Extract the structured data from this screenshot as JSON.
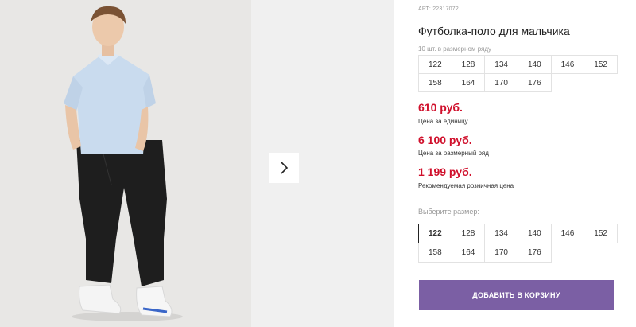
{
  "product": {
    "article_label": "Арт:",
    "article_value": "22317072",
    "title": "Футболка-поло для мальчика",
    "count_note": "10 шт. в размерном ряду",
    "size_range": [
      "122",
      "128",
      "134",
      "140",
      "146",
      "152",
      "158",
      "164",
      "170",
      "176"
    ],
    "prices": [
      {
        "value": "610 руб.",
        "note": "Цена за единицу"
      },
      {
        "value": "6 100 руб.",
        "note": "Цена за размерный ряд"
      },
      {
        "value": "1 199 руб.",
        "note": "Рекомендуемая розничная цена"
      }
    ],
    "choose_label": "Выберите размер:",
    "size_options": [
      "122",
      "128",
      "134",
      "140",
      "146",
      "152",
      "158",
      "164",
      "170",
      "176"
    ],
    "selected_size": "122",
    "add_to_cart_label": "Добавить в корзину"
  },
  "gallery": {
    "next_icon": "chevron-right-icon"
  },
  "colors": {
    "price": "#d0102c",
    "button": "#7b5fa4",
    "shirt": "#c8dcef",
    "pants": "#1e1e1e"
  }
}
